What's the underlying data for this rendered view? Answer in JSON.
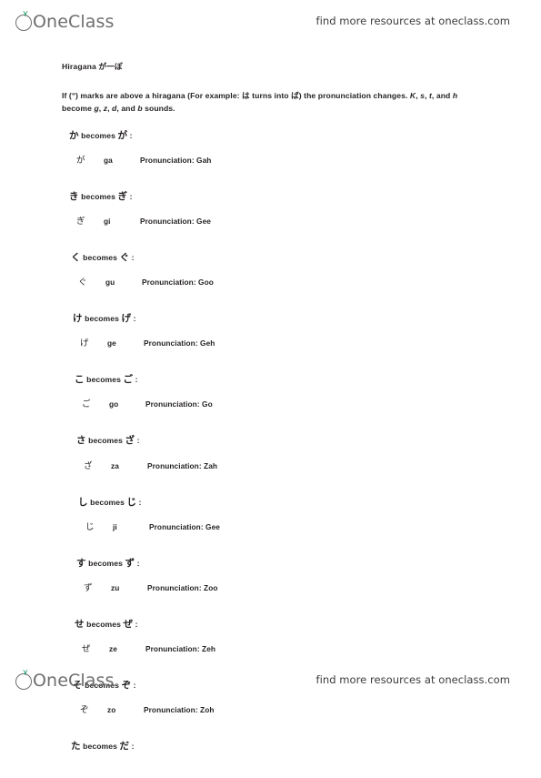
{
  "header": {
    "logo_text": "OneClass",
    "logo_icon": "oneclass-sprout-logo",
    "note": "find more resources at oneclass.com"
  },
  "footer": {
    "logo_text": "OneClass",
    "logo_icon": "oneclass-sprout-logo",
    "note": "find more resources at oneclass.com"
  },
  "document": {
    "title_label": "Hiragana ",
    "title_kana": "が一ぽ",
    "intro": {
      "part1": "If (ʺ) marks are above a hiragana (For example: ",
      "kana1": "は",
      "part2": " turns into ",
      "kana2": "ば",
      "part3": ") the pronunciation changes. ",
      "italic1": "K",
      "part4": ", ",
      "italic2": "s",
      "part5": ", ",
      "italic3": "t",
      "part6": ", and ",
      "italic4": "h",
      "part7": " become ",
      "italic5": "g",
      "part8": ", ",
      "italic6": "z",
      "part9": ", ",
      "italic7": "d",
      "part10": ", and ",
      "italic8": "b",
      "part11": " sounds."
    },
    "entries": [
      {
        "base": "か",
        "becomes_word": " becomes ",
        "result": "が",
        "colon": " :",
        "kana": "が",
        "romaji": "ga",
        "pronunciation": "Pronunciation: Gah",
        "indent": 0
      },
      {
        "base": "き",
        "becomes_word": " becomes ",
        "result": "ぎ",
        "colon": " :",
        "kana": "ぎ",
        "romaji": "gi",
        "pronunciation": "Pronunciation: Gee",
        "indent": 0
      },
      {
        "base": "く",
        "becomes_word": " becomes ",
        "result": "ぐ",
        "colon": " :",
        "kana": "ぐ",
        "romaji": "gu",
        "pronunciation": "Pronunciation: Goo",
        "indent": 2
      },
      {
        "base": "け",
        "becomes_word": " becomes ",
        "result": "げ",
        "colon": " :",
        "kana": "げ",
        "romaji": "ge",
        "pronunciation": "Pronunciation: Geh",
        "indent": 4
      },
      {
        "base": "こ",
        "becomes_word": " becomes ",
        "result": "ご",
        "colon": " :",
        "kana": "ご",
        "romaji": "go",
        "pronunciation": "Pronunciation: Go",
        "indent": 6
      },
      {
        "base": "さ",
        "becomes_word": " becomes ",
        "result": "ざ",
        "colon": " :",
        "kana": "ざ",
        "romaji": "za",
        "pronunciation": "Pronunciation: Zah",
        "indent": 8
      },
      {
        "base": "し",
        "becomes_word": " becomes ",
        "result": "じ",
        "colon": " :",
        "kana": "じ",
        "romaji": "ji",
        "pronunciation": "Pronunciation: Gee",
        "indent": 10
      },
      {
        "base": "す",
        "becomes_word": " becomes ",
        "result": "ず",
        "colon": " :",
        "kana": "ず",
        "romaji": "zu",
        "pronunciation": "Pronunciation: Zoo",
        "indent": 8
      },
      {
        "base": "せ",
        "becomes_word": " becomes ",
        "result": "ぜ",
        "colon": " :",
        "kana": "ぜ",
        "romaji": "ze",
        "pronunciation": "Pronunciation: Zeh",
        "indent": 6
      },
      {
        "base": "そ",
        "becomes_word": " becomes ",
        "result": "ぞ",
        "colon": " :",
        "kana": "ぞ",
        "romaji": "zo",
        "pronunciation": "Pronunciation: Zoh",
        "indent": 4
      },
      {
        "base": "た",
        "becomes_word": " becomes ",
        "result": "だ",
        "colon": " :",
        "kana": "",
        "romaji": "",
        "pronunciation": "",
        "indent": 2
      }
    ]
  },
  "colors": {
    "logo_gray": "#6d6e70",
    "leaf_green": "#169b62",
    "text": "#231f20"
  }
}
